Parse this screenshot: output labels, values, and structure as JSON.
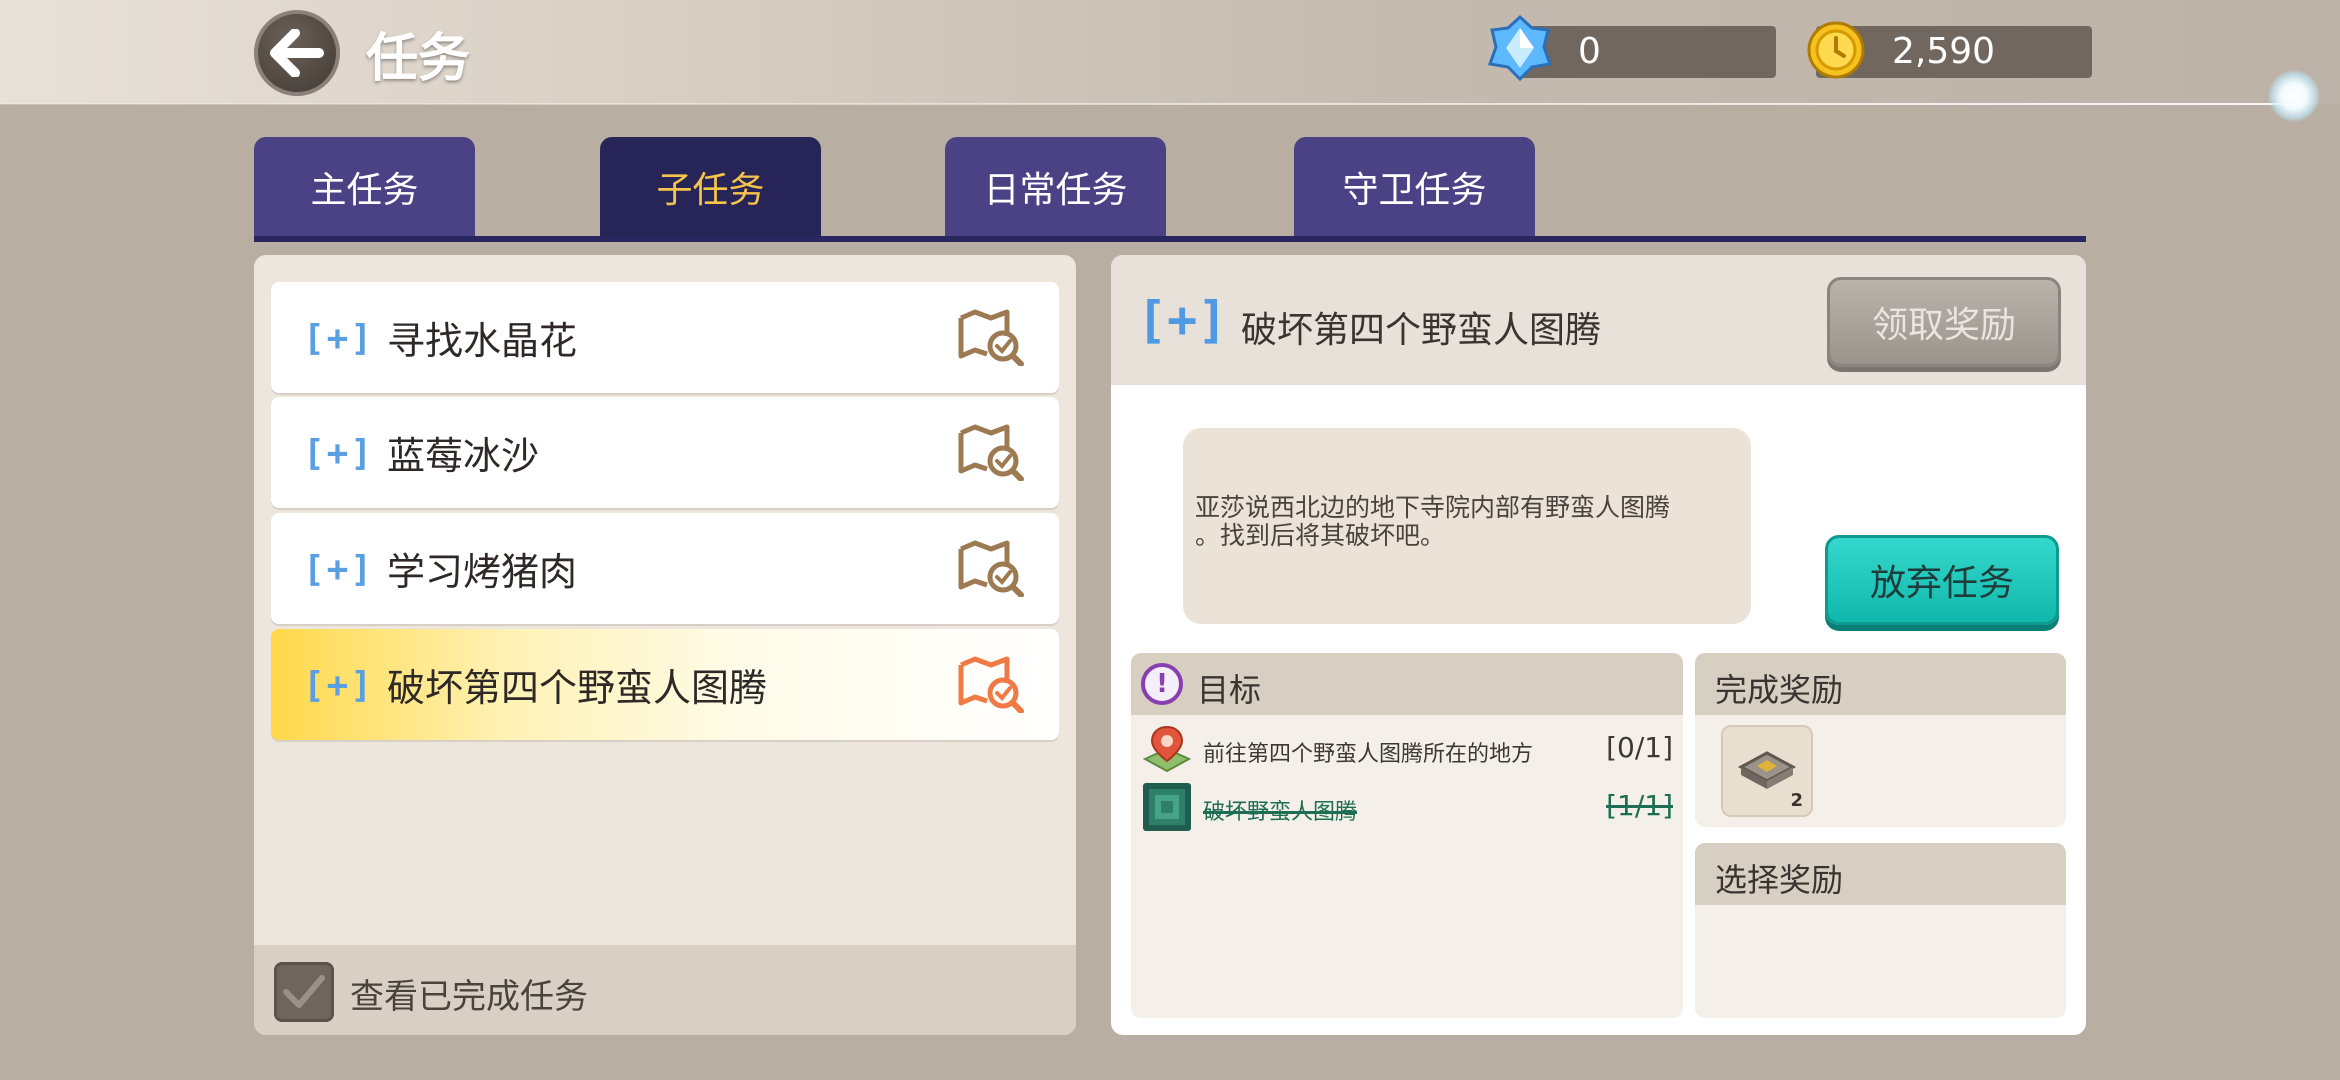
{
  "header": {
    "title": "任务",
    "gems": "0",
    "gold": "2,590"
  },
  "tabs": [
    {
      "label": "主任务",
      "active": false
    },
    {
      "label": "子任务",
      "active": true
    },
    {
      "label": "日常任务",
      "active": false
    },
    {
      "label": "守卫任务",
      "active": false
    }
  ],
  "quest_list": {
    "items": [
      {
        "marker": "[+]",
        "name": "寻找水晶花",
        "selected": false
      },
      {
        "marker": "[+]",
        "name": "蓝莓冰沙",
        "selected": false
      },
      {
        "marker": "[+]",
        "name": "学习烤猪肉",
        "selected": false
      },
      {
        "marker": "[+]",
        "name": "破坏第四个野蛮人图腾",
        "selected": true
      }
    ],
    "show_completed_label": "查看已完成任务"
  },
  "detail": {
    "marker": "[+]",
    "title": "破坏第四个野蛮人图腾",
    "claim_button": "领取奖励",
    "description_line1": "亚莎说西北边的地下寺院内部有野蛮人图腾",
    "description_line2": "。找到后将其破坏吧。",
    "abandon_button": "放弃任务",
    "goal": {
      "icon_glyph": "!",
      "title": "目标",
      "objectives": [
        {
          "text": "前往第四个野蛮人图腾所在的地方",
          "count": "[0/1]",
          "done": false
        },
        {
          "text": "破坏野蛮人图腾",
          "count": "[1/1]",
          "done": true
        }
      ]
    },
    "completion_reward": {
      "title": "完成奖励",
      "item_qty": "2"
    },
    "choice_reward": {
      "title": "选择奖励"
    }
  },
  "icons": {
    "back": "back-arrow-icon",
    "gem": "crystal-gem-icon",
    "coin": "gold-coin-icon",
    "quest_map": "map-check-icon",
    "checkbox": "checkmark-icon",
    "goal": "exclamation-icon",
    "objective_location": "location-pin-icon",
    "objective_totem": "totem-block-icon",
    "reward_item": "stone-tablet-icon"
  },
  "colors": {
    "tab_bg": "#4a4284",
    "tab_active_bg": "#272458",
    "tab_active_text": "#f5c44a",
    "selected_quest": "#ffd84a",
    "abandon_button": "#1fc9bc",
    "claim_button_disabled": "#a9a39c"
  }
}
